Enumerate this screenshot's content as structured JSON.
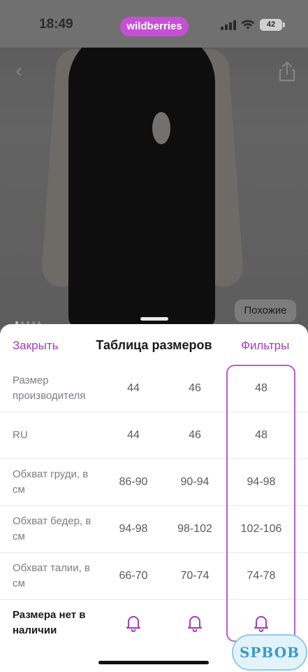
{
  "status_bar": {
    "time": "18:49",
    "brand": "wildberries",
    "battery": "42",
    "signal_icon": "cellular-signal-icon",
    "wifi_icon": "wifi-icon"
  },
  "product_view": {
    "back_icon": "chevron-left-icon",
    "share_icon": "share-icon",
    "similar_label": "Похожие"
  },
  "size_sheet": {
    "close_label": "Закрыть",
    "title": "Таблица размеров",
    "filters_label": "Фильтры",
    "rows": [
      {
        "label": "Размер производителя",
        "values": [
          "44",
          "46",
          "48"
        ]
      },
      {
        "label": "RU",
        "values": [
          "44",
          "46",
          "48"
        ]
      },
      {
        "label": "Обхват груди, в см",
        "values": [
          "86-90",
          "90-94",
          "94-98"
        ]
      },
      {
        "label": "Обхват бедер, в см",
        "values": [
          "94-98",
          "98-102",
          "102-106"
        ]
      },
      {
        "label": "Обхват талии, в см",
        "values": [
          "66-70",
          "70-74",
          "74-78"
        ]
      }
    ],
    "unavailable_label": "Размера нет в наличии",
    "notify_icon": "bell-icon"
  },
  "colors": {
    "accent": "#a23dbd",
    "brand": "#c64fd6",
    "highlight_border": "#b45fc8"
  },
  "watermark": "SPBOB"
}
